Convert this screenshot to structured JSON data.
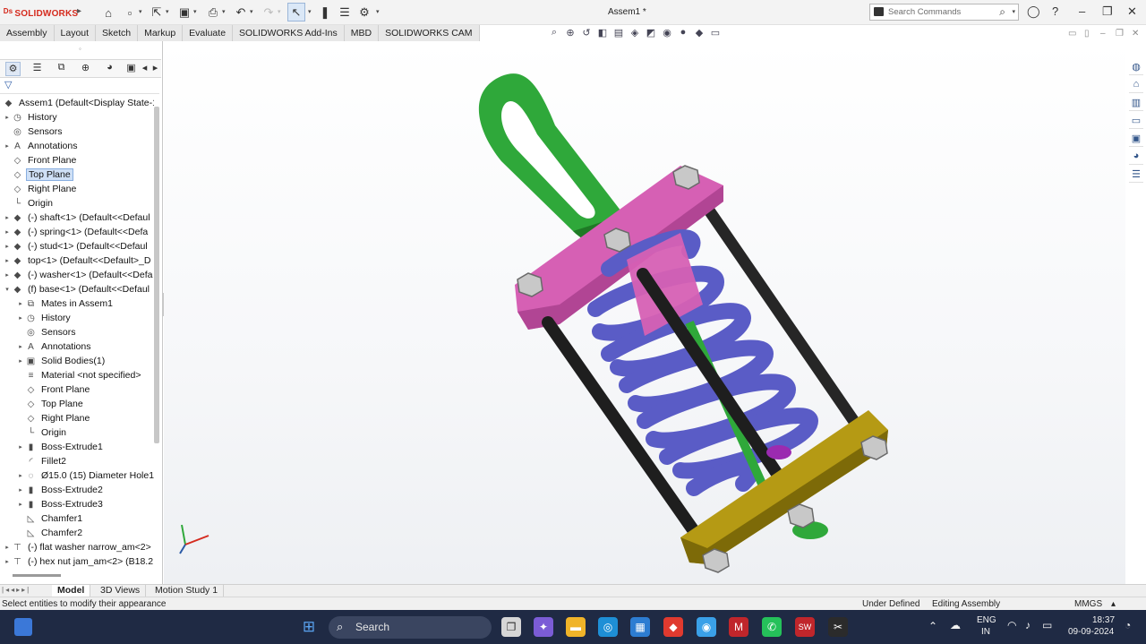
{
  "app": {
    "logo": "SOLIDWORKS",
    "window_title": "Assem1 *",
    "search_placeholder": "Search Commands"
  },
  "command_tabs": [
    "Assembly",
    "Layout",
    "Sketch",
    "Markup",
    "Evaluate",
    "SOLIDWORKS Add-Ins",
    "MBD",
    "SOLIDWORKS CAM"
  ],
  "tree": {
    "root": "Assem1  (Default<Display State-1",
    "items": [
      {
        "label": "History",
        "level": 1,
        "expand": "▸",
        "icon": "history-icon"
      },
      {
        "label": "Sensors",
        "level": 1,
        "expand": "",
        "icon": "sensors-icon"
      },
      {
        "label": "Annotations",
        "level": 1,
        "expand": "▸",
        "icon": "annotations-icon"
      },
      {
        "label": "Front Plane",
        "level": 1,
        "expand": "",
        "icon": "plane-icon"
      },
      {
        "label": "Top Plane",
        "level": 1,
        "expand": "",
        "icon": "plane-icon",
        "selected": true
      },
      {
        "label": "Right Plane",
        "level": 1,
        "expand": "",
        "icon": "plane-icon"
      },
      {
        "label": "Origin",
        "level": 1,
        "expand": "",
        "icon": "origin-icon"
      },
      {
        "label": "(-) shaft<1> (Default<<Defaul",
        "level": 1,
        "expand": "▸",
        "icon": "part-icon"
      },
      {
        "label": "(-) spring<1> (Default<<Defa",
        "level": 1,
        "expand": "▸",
        "icon": "part-icon"
      },
      {
        "label": "(-) stud<1> (Default<<Defaul",
        "level": 1,
        "expand": "▸",
        "icon": "part-icon"
      },
      {
        "label": "top<1> (Default<<Default>_D",
        "level": 1,
        "expand": "▸",
        "icon": "part-icon"
      },
      {
        "label": "(-) washer<1> (Default<<Defa",
        "level": 1,
        "expand": "▸",
        "icon": "part-icon"
      },
      {
        "label": "(f) base<1> (Default<<Defaul",
        "level": 1,
        "expand": "▾",
        "icon": "part-icon"
      },
      {
        "label": "Mates in Assem1",
        "level": 2,
        "expand": "▸",
        "icon": "mates-icon"
      },
      {
        "label": "History",
        "level": 2,
        "expand": "▸",
        "icon": "history-icon"
      },
      {
        "label": "Sensors",
        "level": 2,
        "expand": "",
        "icon": "sensors-icon"
      },
      {
        "label": "Annotations",
        "level": 2,
        "expand": "▸",
        "icon": "annotations-icon"
      },
      {
        "label": "Solid Bodies(1)",
        "level": 2,
        "expand": "▸",
        "icon": "solid-bodies-icon"
      },
      {
        "label": "Material <not specified>",
        "level": 2,
        "expand": "",
        "icon": "material-icon"
      },
      {
        "label": "Front Plane",
        "level": 2,
        "expand": "",
        "icon": "plane-icon"
      },
      {
        "label": "Top Plane",
        "level": 2,
        "expand": "",
        "icon": "plane-icon"
      },
      {
        "label": "Right Plane",
        "level": 2,
        "expand": "",
        "icon": "plane-icon"
      },
      {
        "label": "Origin",
        "level": 2,
        "expand": "",
        "icon": "origin-icon"
      },
      {
        "label": "Boss-Extrude1",
        "level": 2,
        "expand": "▸",
        "icon": "extrude-icon"
      },
      {
        "label": "Fillet2",
        "level": 2,
        "expand": "",
        "icon": "fillet-icon"
      },
      {
        "label": "Ø15.0 (15) Diameter Hole1",
        "level": 2,
        "expand": "▸",
        "icon": "hole-icon"
      },
      {
        "label": "Boss-Extrude2",
        "level": 2,
        "expand": "▸",
        "icon": "extrude-icon"
      },
      {
        "label": "Boss-Extrude3",
        "level": 2,
        "expand": "▸",
        "icon": "extrude-icon"
      },
      {
        "label": "Chamfer1",
        "level": 2,
        "expand": "",
        "icon": "chamfer-icon"
      },
      {
        "label": "Chamfer2",
        "level": 2,
        "expand": "",
        "icon": "chamfer-icon"
      },
      {
        "label": "(-) flat washer narrow_am<2>",
        "level": 1,
        "expand": "▸",
        "icon": "toolbox-part-icon"
      },
      {
        "label": "(-) hex nut jam_am<2> (B18.2.",
        "level": 1,
        "expand": "▸",
        "icon": "toolbox-part-icon"
      }
    ]
  },
  "bottom_tabs": [
    "Model",
    "3D Views",
    "Motion Study 1"
  ],
  "status": {
    "message": "Select entities to modify their appearance",
    "state": "Under Defined",
    "mode": "Editing Assembly",
    "units": "MMGS"
  },
  "taskbar": {
    "search_label": "Search",
    "lang": "ENG",
    "region": "IN",
    "time": "18:37",
    "date": "09-09-2024"
  },
  "colors": {
    "hook": "#2fa83a",
    "plate": "#d660b4",
    "spring": "#5a5cc6",
    "base": "#b59a14",
    "stud": "#2a2a2a",
    "bolt": "#c8c8c8"
  }
}
